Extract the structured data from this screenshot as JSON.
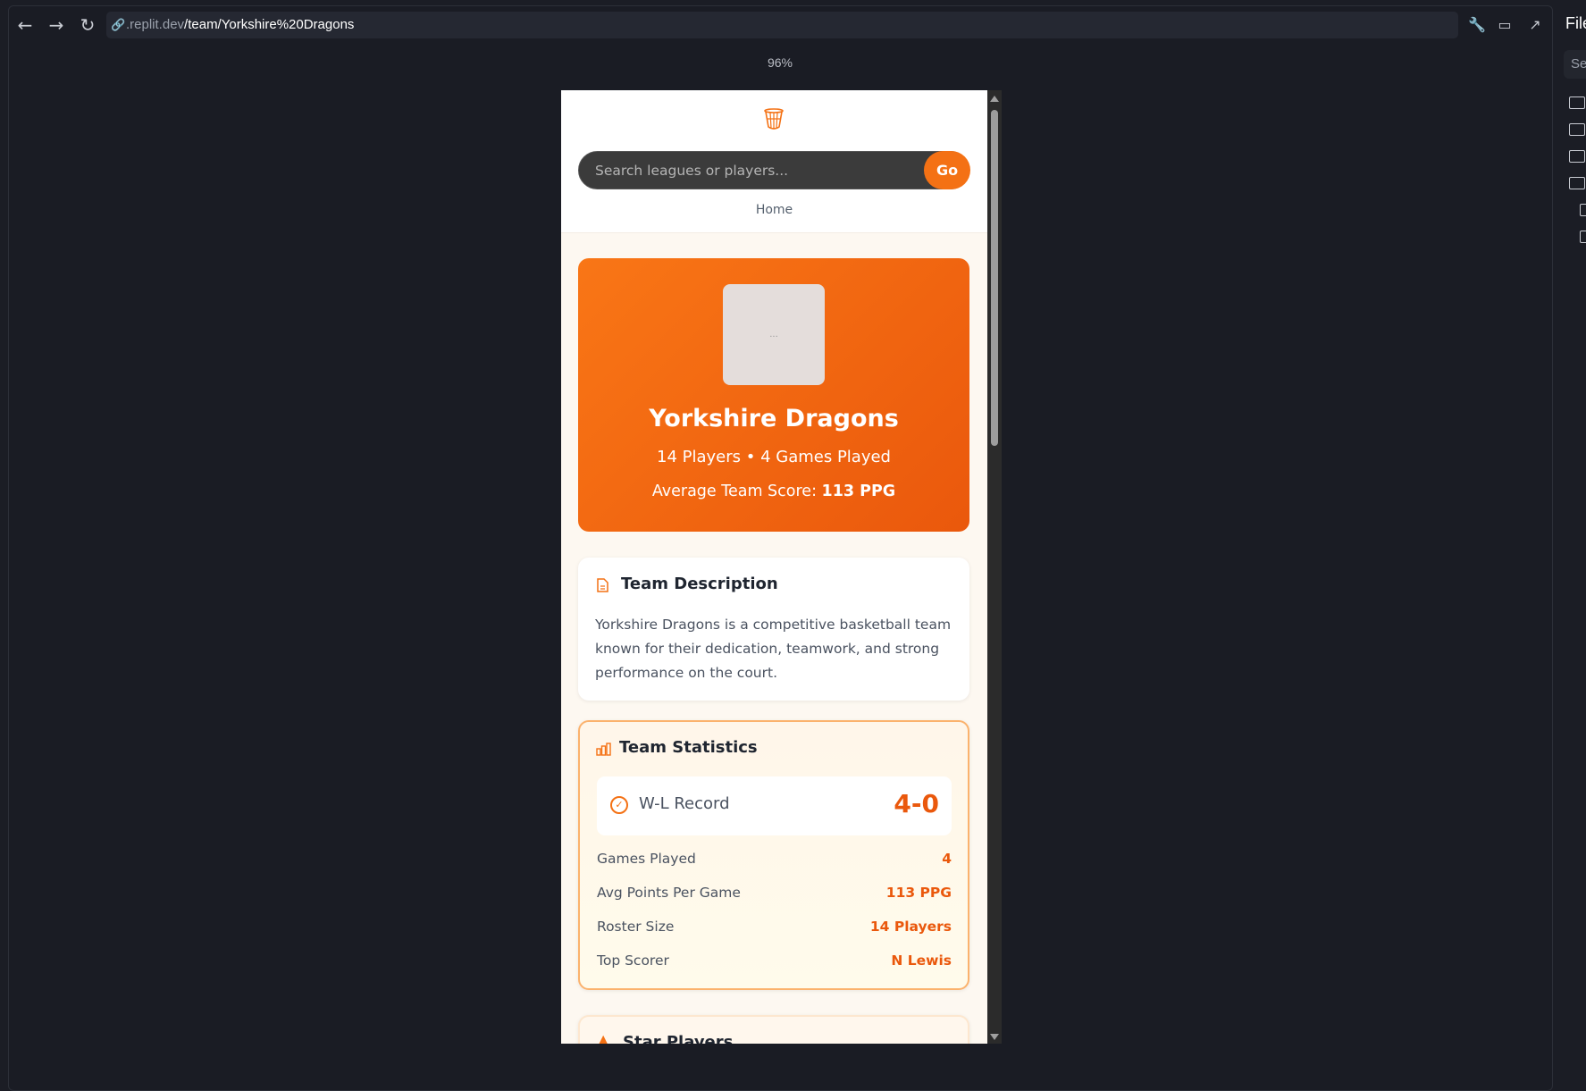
{
  "browser": {
    "url_host": ".replit.dev",
    "url_path": "/team/Yorkshire%20Dragons",
    "zoom": "96%",
    "right_panel_title": "Files",
    "right_panel_search": "Se"
  },
  "app": {
    "search_placeholder": "Search leagues or players...",
    "go_label": "Go",
    "nav_home": "Home"
  },
  "hero": {
    "image_alt": "...",
    "team_name": "Yorkshire Dragons",
    "subtitle": "14 Players • 4 Games Played",
    "avg_label": "Average Team Score: ",
    "avg_value": "113 PPG"
  },
  "description": {
    "title": "Team Description",
    "text": "Yorkshire Dragons is a competitive basketball team known for their dedication, teamwork, and strong performance on the court."
  },
  "stats": {
    "title": "Team Statistics",
    "record_label": "W-L Record",
    "record_value": "4-0",
    "rows": [
      {
        "label": "Games Played",
        "value": "4"
      },
      {
        "label": "Avg Points Per Game",
        "value": "113 PPG"
      },
      {
        "label": "Roster Size",
        "value": "14 Players"
      },
      {
        "label": "Top Scorer",
        "value": "N Lewis"
      }
    ]
  },
  "star": {
    "title": "Star Players"
  },
  "colors": {
    "accent": "#f47114",
    "accent_dark": "#ea580c",
    "bg": "#fdf8f1"
  }
}
